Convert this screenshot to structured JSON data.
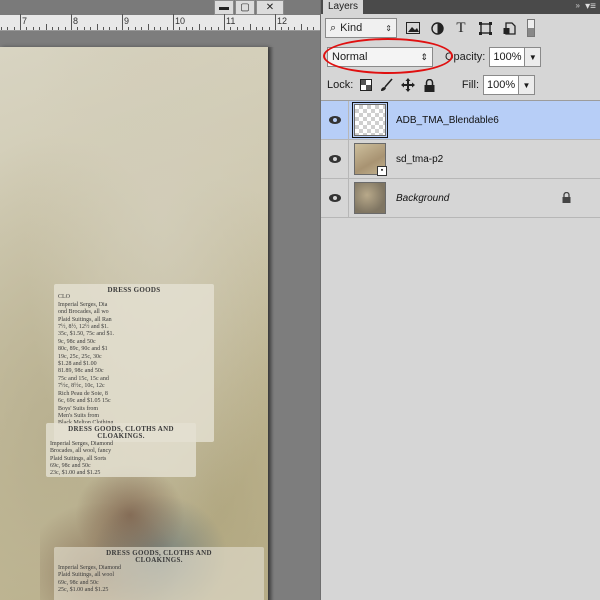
{
  "window_controls": {
    "minimize": "▬",
    "maximize": "▢",
    "close": "✕"
  },
  "ruler": {
    "labels": [
      "7",
      "8",
      "9",
      "10",
      "11",
      "12"
    ]
  },
  "document": {
    "clip1": {
      "heading": "DRESS GOODS",
      "lines": [
        "CLO",
        "Imperial Serges, Dia",
        "ond Brocades, all wo",
        "Plaid Suitings, all Ran",
        "",
        "7½, 8½, 12½ and $1.",
        "35c, $1.50, 75c and $1.",
        "9c, 98c and 50c",
        "80c, 89c, 90c and $1",
        "19c, 25c, 25c, 30c",
        "$1.28 and $1.00",
        "81.89, 98c and 50c",
        "75c and 15c, 15c and",
        "7½c, 8½c, 10c, 12c",
        "Rich Peau de Soie, 8",
        "6c, 69c and $1.05 15c",
        "Boys' Suits from",
        "Men's Suits from",
        "Black Melton Clothing"
      ]
    },
    "clip2": {
      "heading": "DRESS GOODS, CLOTHS AND",
      "sub": "CLOAKINGS.",
      "lines": [
        "Imperial Serges, Diamond",
        "Brocades, all wool, fancy",
        "Plaid Suitings, all Sorts",
        "69c, 98c and 50c",
        "23c, $1.00 and $1.25"
      ]
    },
    "clip3": {
      "heading": "DRESS GOODS, CLOTHS AND",
      "sub": "CLOAKINGS.",
      "lines": [
        "Imperial Serges, Diamond",
        "Plaid Suitings, all wool",
        "69c, 98c and 50c",
        "25c, $1.00 and $1.25"
      ]
    }
  },
  "panel": {
    "tab_label": "Layers",
    "collapse_icon": "»",
    "menu_icon": "▾≡",
    "filter": {
      "search_glyph": "⌕",
      "kind_label": "Kind",
      "icons": [
        "image-filter-icon",
        "adjustment-filter-icon",
        "type-filter-icon",
        "shape-filter-icon",
        "smart-object-filter-icon"
      ]
    },
    "blend_mode": "Normal",
    "opacity_label": "Opacity:",
    "opacity_value": "100%",
    "lock_label": "Lock:",
    "fill_label": "Fill:",
    "fill_value": "100%",
    "layers": [
      {
        "name": "ADB_TMA_Blendable6",
        "selected": true,
        "thumb": "transparent",
        "italic": false,
        "locked": false
      },
      {
        "name": "sd_tma-p2",
        "selected": false,
        "thumb": "paper",
        "italic": false,
        "locked": false,
        "smart": true
      },
      {
        "name": "Background",
        "selected": false,
        "thumb": "bg",
        "italic": true,
        "locked": true
      }
    ],
    "highlight_color": "#e01010"
  }
}
